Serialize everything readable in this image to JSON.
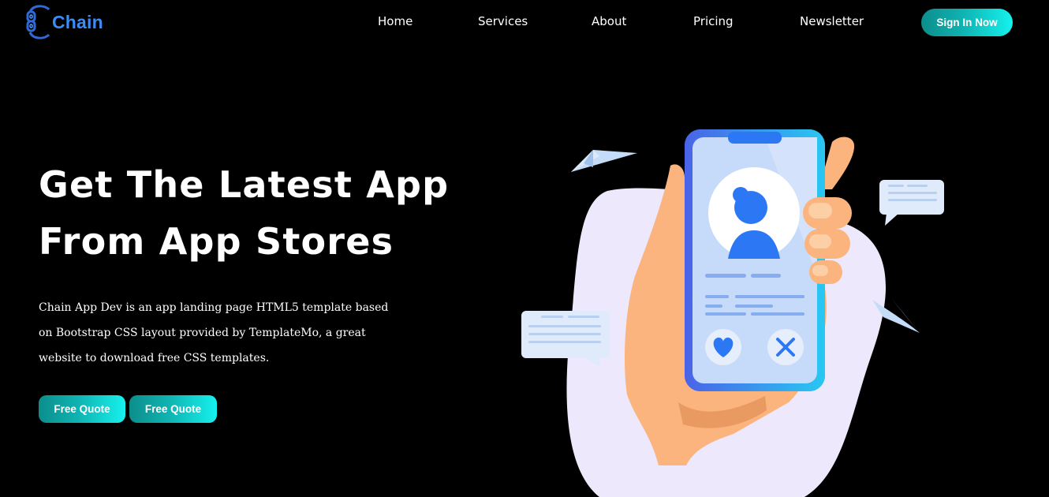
{
  "brand": {
    "name": "Chain",
    "logo_icon": "chain-link-icon",
    "color": "#3b8cf5"
  },
  "nav": {
    "items": [
      {
        "label": "Home"
      },
      {
        "label": "Services"
      },
      {
        "label": "About"
      },
      {
        "label": "Pricing"
      },
      {
        "label": "Newsletter"
      }
    ],
    "signin_label": "Sign In Now"
  },
  "hero": {
    "headline_line1": "Get The Latest App",
    "headline_line2": "From App Stores",
    "description": "Chain App Dev is an app landing page HTML5 template based on Bootstrap CSS layout provided by TemplateMo, a great website to download free CSS templates.",
    "buttons": [
      {
        "label": "Free Quote"
      },
      {
        "label": "Free Quote"
      }
    ]
  },
  "colors": {
    "accent_gradient_start": "#0c8e8c",
    "accent_gradient_end": "#16f1ee",
    "phone_blue": "#2c78f4",
    "background": "#000000"
  },
  "illustration": {
    "icons": [
      "paper-plane-icon",
      "chat-bubble-icon",
      "phone-icon",
      "user-avatar-icon",
      "heart-icon",
      "close-icon"
    ]
  }
}
